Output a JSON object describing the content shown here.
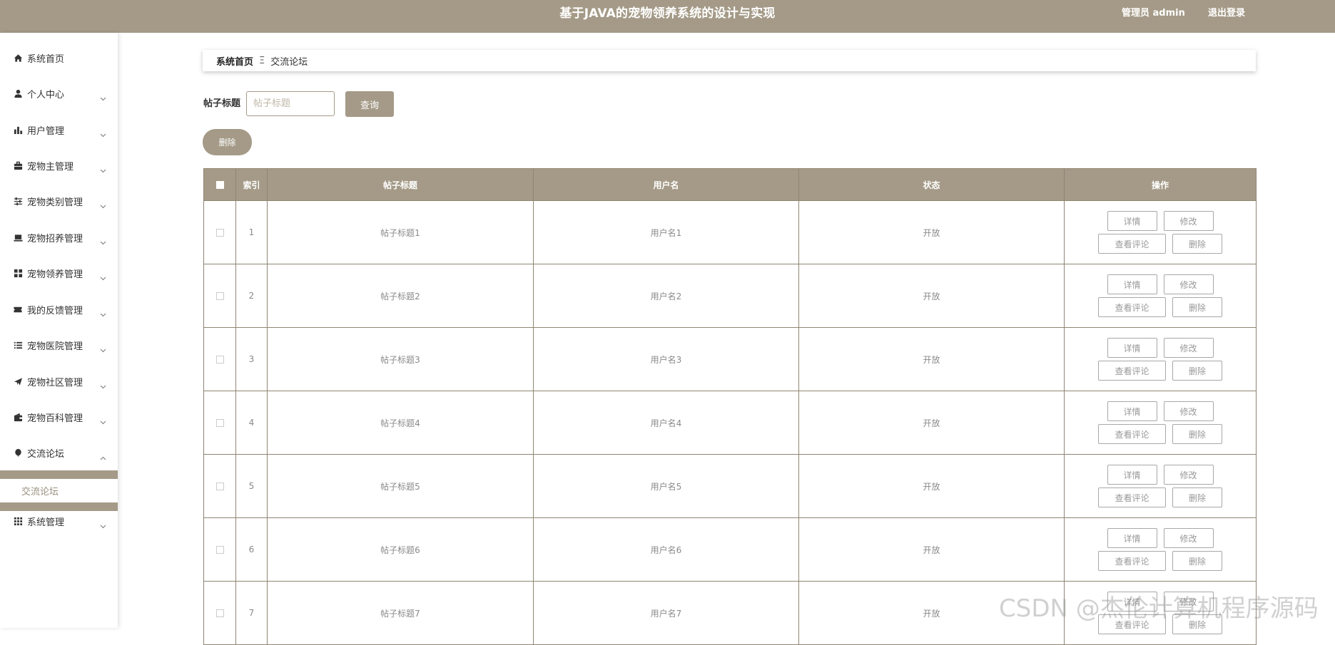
{
  "header": {
    "title": "基于JAVA的宠物领养系统的设计与实现",
    "admin_label": "管理员 admin",
    "logout_label": "退出登录"
  },
  "sidebar": {
    "items": [
      {
        "label": "系统首页",
        "icon": "home-icon",
        "has_arrow": false
      },
      {
        "label": "个人中心",
        "icon": "user-icon",
        "has_arrow": true
      },
      {
        "label": "用户管理",
        "icon": "bar-chart-icon",
        "has_arrow": true
      },
      {
        "label": "宠物主管理",
        "icon": "briefcase-icon",
        "has_arrow": true
      },
      {
        "label": "宠物类别管理",
        "icon": "sliders-icon",
        "has_arrow": true
      },
      {
        "label": "宠物招养管理",
        "icon": "laptop-icon",
        "has_arrow": true
      },
      {
        "label": "宠物领养管理",
        "icon": "grid-icon",
        "has_arrow": true
      },
      {
        "label": "我的反馈管理",
        "icon": "ticket-icon",
        "has_arrow": true
      },
      {
        "label": "宠物医院管理",
        "icon": "list-icon",
        "has_arrow": true
      },
      {
        "label": "宠物社区管理",
        "icon": "paper-plane-icon",
        "has_arrow": true
      },
      {
        "label": "宠物百科管理",
        "icon": "wallet-icon",
        "has_arrow": true
      },
      {
        "label": "交流论坛",
        "icon": "balloon-icon",
        "has_arrow": true,
        "expanded": true
      },
      {
        "label": "系统管理",
        "icon": "apps-icon",
        "has_arrow": true
      }
    ],
    "active_sub_item": "交流论坛"
  },
  "breadcrumb": {
    "home": "系统首页",
    "separator": "Ξ",
    "current": "交流论坛"
  },
  "search": {
    "label": "帖子标题",
    "placeholder": "帖子标题",
    "value": "",
    "button": "查询"
  },
  "actions": {
    "delete_label": "删除"
  },
  "table": {
    "columns": [
      "索引",
      "帖子标题",
      "用户名",
      "状态",
      "操作"
    ],
    "op_labels": {
      "detail": "详情",
      "edit": "修改",
      "comments": "查看评论",
      "delete": "删除"
    },
    "rows": [
      {
        "index": "1",
        "title": "帖子标题1",
        "username": "用户名1",
        "status": "开放"
      },
      {
        "index": "2",
        "title": "帖子标题2",
        "username": "用户名2",
        "status": "开放"
      },
      {
        "index": "3",
        "title": "帖子标题3",
        "username": "用户名3",
        "status": "开放"
      },
      {
        "index": "4",
        "title": "帖子标题4",
        "username": "用户名4",
        "status": "开放"
      },
      {
        "index": "5",
        "title": "帖子标题5",
        "username": "用户名5",
        "status": "开放"
      },
      {
        "index": "6",
        "title": "帖子标题6",
        "username": "用户名6",
        "status": "开放"
      },
      {
        "index": "7",
        "title": "帖子标题7",
        "username": "用户名7",
        "status": "开放"
      }
    ]
  },
  "watermark": "CSDN @杰伦计算机程序源码",
  "colors": {
    "accent": "#a49a87",
    "border": "#8f8573",
    "text_muted": "#8a8a8a"
  }
}
